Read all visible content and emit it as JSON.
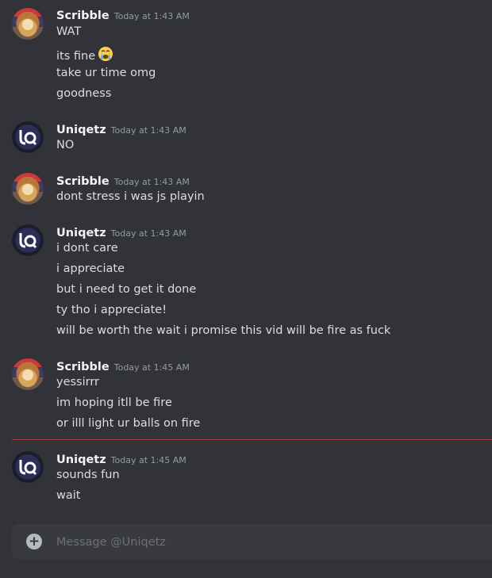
{
  "conversation": {
    "groups": [
      {
        "author": "Scribble",
        "timestamp": "Today at 1:43 AM",
        "avatar": "scribble-avatar",
        "lines": [
          "WAT",
          "its fine",
          "take ur time omg",
          "goodness"
        ]
      },
      {
        "author": "Uniqetz",
        "timestamp": "Today at 1:43 AM",
        "avatar": "uniqetz-avatar",
        "lines": [
          "NO"
        ]
      },
      {
        "author": "Scribble",
        "timestamp": "Today at 1:43 AM",
        "avatar": "scribble-avatar",
        "lines": [
          "dont stress i was js playin"
        ]
      },
      {
        "author": "Uniqetz",
        "timestamp": "Today at 1:43 AM",
        "avatar": "uniqetz-avatar",
        "lines": [
          "i dont care",
          "i appreciate",
          "but i need to get it done",
          "ty tho i appreciate!",
          "will be worth the wait i promise this vid will be fire as fuck"
        ]
      },
      {
        "author": "Scribble",
        "timestamp": "Today at 1:45 AM",
        "avatar": "scribble-avatar",
        "lines": [
          "yessirrr",
          "im hoping itll be fire",
          "or illl light ur balls on fire"
        ]
      },
      {
        "author": "Uniqetz",
        "timestamp": "Today at 1:45 AM",
        "avatar": "uniqetz-avatar",
        "lines": [
          "sounds fun",
          "wait"
        ]
      }
    ],
    "emoji_after_line": "loudly-crying-face-emoji"
  },
  "composer": {
    "placeholder": "Message @Uniqetz",
    "add_icon": "plus-circle-icon"
  },
  "colors": {
    "background": "#313338",
    "composer": "#383a40",
    "new_messages_divider": "#a13a3f",
    "username": "#f2f3f5",
    "timestamp": "#949ba4"
  }
}
